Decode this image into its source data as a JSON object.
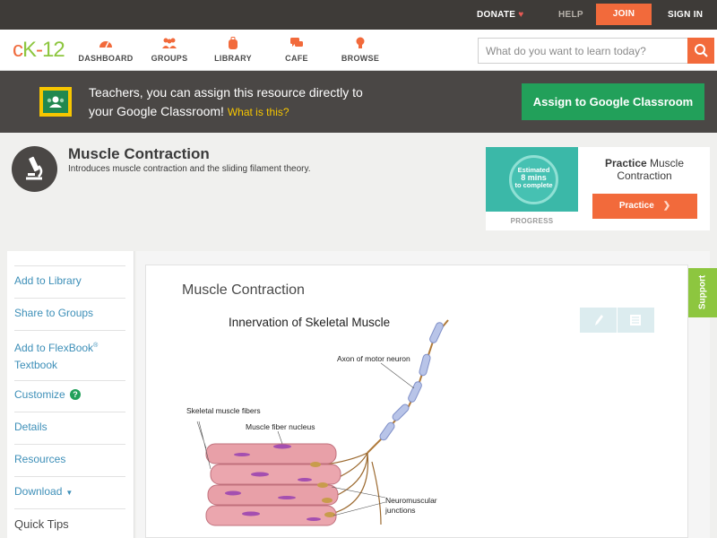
{
  "topbar": {
    "donate": "DONATE",
    "help": "HELP",
    "join": "JOIN",
    "signin": "SIGN IN"
  },
  "nav": {
    "logo_c": "c",
    "logo_k": "K",
    "logo_dash": "-",
    "logo_12": "12",
    "items": [
      {
        "label": "DASHBOARD",
        "icon": "gauge-icon"
      },
      {
        "label": "GROUPS",
        "icon": "people-icon"
      },
      {
        "label": "LIBRARY",
        "icon": "backpack-icon"
      },
      {
        "label": "CAFE",
        "icon": "chat-icon"
      },
      {
        "label": "BROWSE",
        "icon": "lightbulb-icon"
      }
    ],
    "search_placeholder": "What do you want to learn today?"
  },
  "banner": {
    "line1": "Teachers, you can assign this resource directly to",
    "line2": "your Google Classroom!",
    "what": "What is this?",
    "assign": "Assign to Google Classroom"
  },
  "concept": {
    "title": "Muscle Contraction",
    "description": "Introduces muscle contraction and the sliding filament theory."
  },
  "practice": {
    "estimated": "Estimated",
    "mins": "8 mins",
    "to_complete": "to complete",
    "progress": "PROGRESS",
    "title_bold": "Practice",
    "title_rest": "Muscle Contraction",
    "button": "Practice"
  },
  "sidebar": {
    "add_library": "Add to Library",
    "share": "Share to Groups",
    "flexbook_1": "Add to FlexBook",
    "flexbook_reg": "®",
    "flexbook_2": "Textbook",
    "customize": "Customize",
    "customize_badge": "?",
    "details": "Details",
    "resources": "Resources",
    "download": "Download",
    "quick_tips": "Quick Tips"
  },
  "main": {
    "title": "Muscle Contraction",
    "support": "Support"
  },
  "diagram": {
    "title": "Innervation of Skeletal Muscle",
    "axon": "Axon of motor neuron",
    "fibers": "Skeletal muscle fibers",
    "nucleus": "Muscle fiber nucleus",
    "nmj1": "Neuromuscular",
    "nmj2": "junctions"
  },
  "colors": {
    "accent": "#f26a3b",
    "green": "#22a05a",
    "brand_green": "#8dc63f",
    "link": "#3d8fb8"
  }
}
